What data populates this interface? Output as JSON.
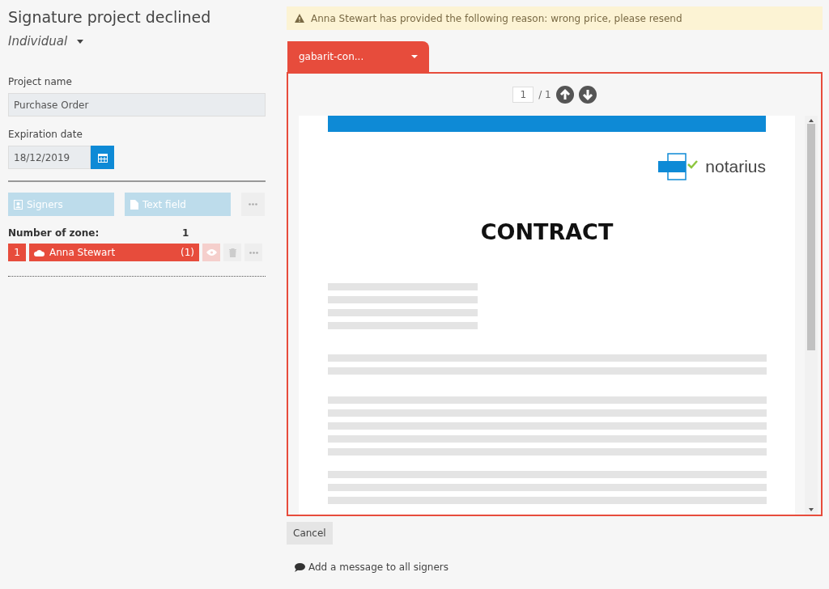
{
  "title": "Signature project declined",
  "project_type": "Individual",
  "project_name": {
    "label": "Project name",
    "value": "Purchase Order"
  },
  "expiration": {
    "label": "Expiration date",
    "value": "18/12/2019"
  },
  "tools": [
    {
      "kind": "signers",
      "label": "Signers"
    },
    {
      "kind": "text",
      "label": "Text field"
    }
  ],
  "zone_count": {
    "label": "Number of zone:",
    "value": "1"
  },
  "signers": [
    {
      "number": "1",
      "name": "Anna Stewart",
      "count": "(1)"
    }
  ],
  "alert": "Anna Stewart has provided the following reason: wrong price, please resend",
  "document_tab": {
    "label": "gabarit-con...",
    "selected": true
  },
  "pager": {
    "page": "1",
    "total": "/ 1"
  },
  "document": {
    "logo": "notarius",
    "heading": "CONTRACT"
  },
  "cancel": "Cancel",
  "message_link": "Add a message to all signers"
}
